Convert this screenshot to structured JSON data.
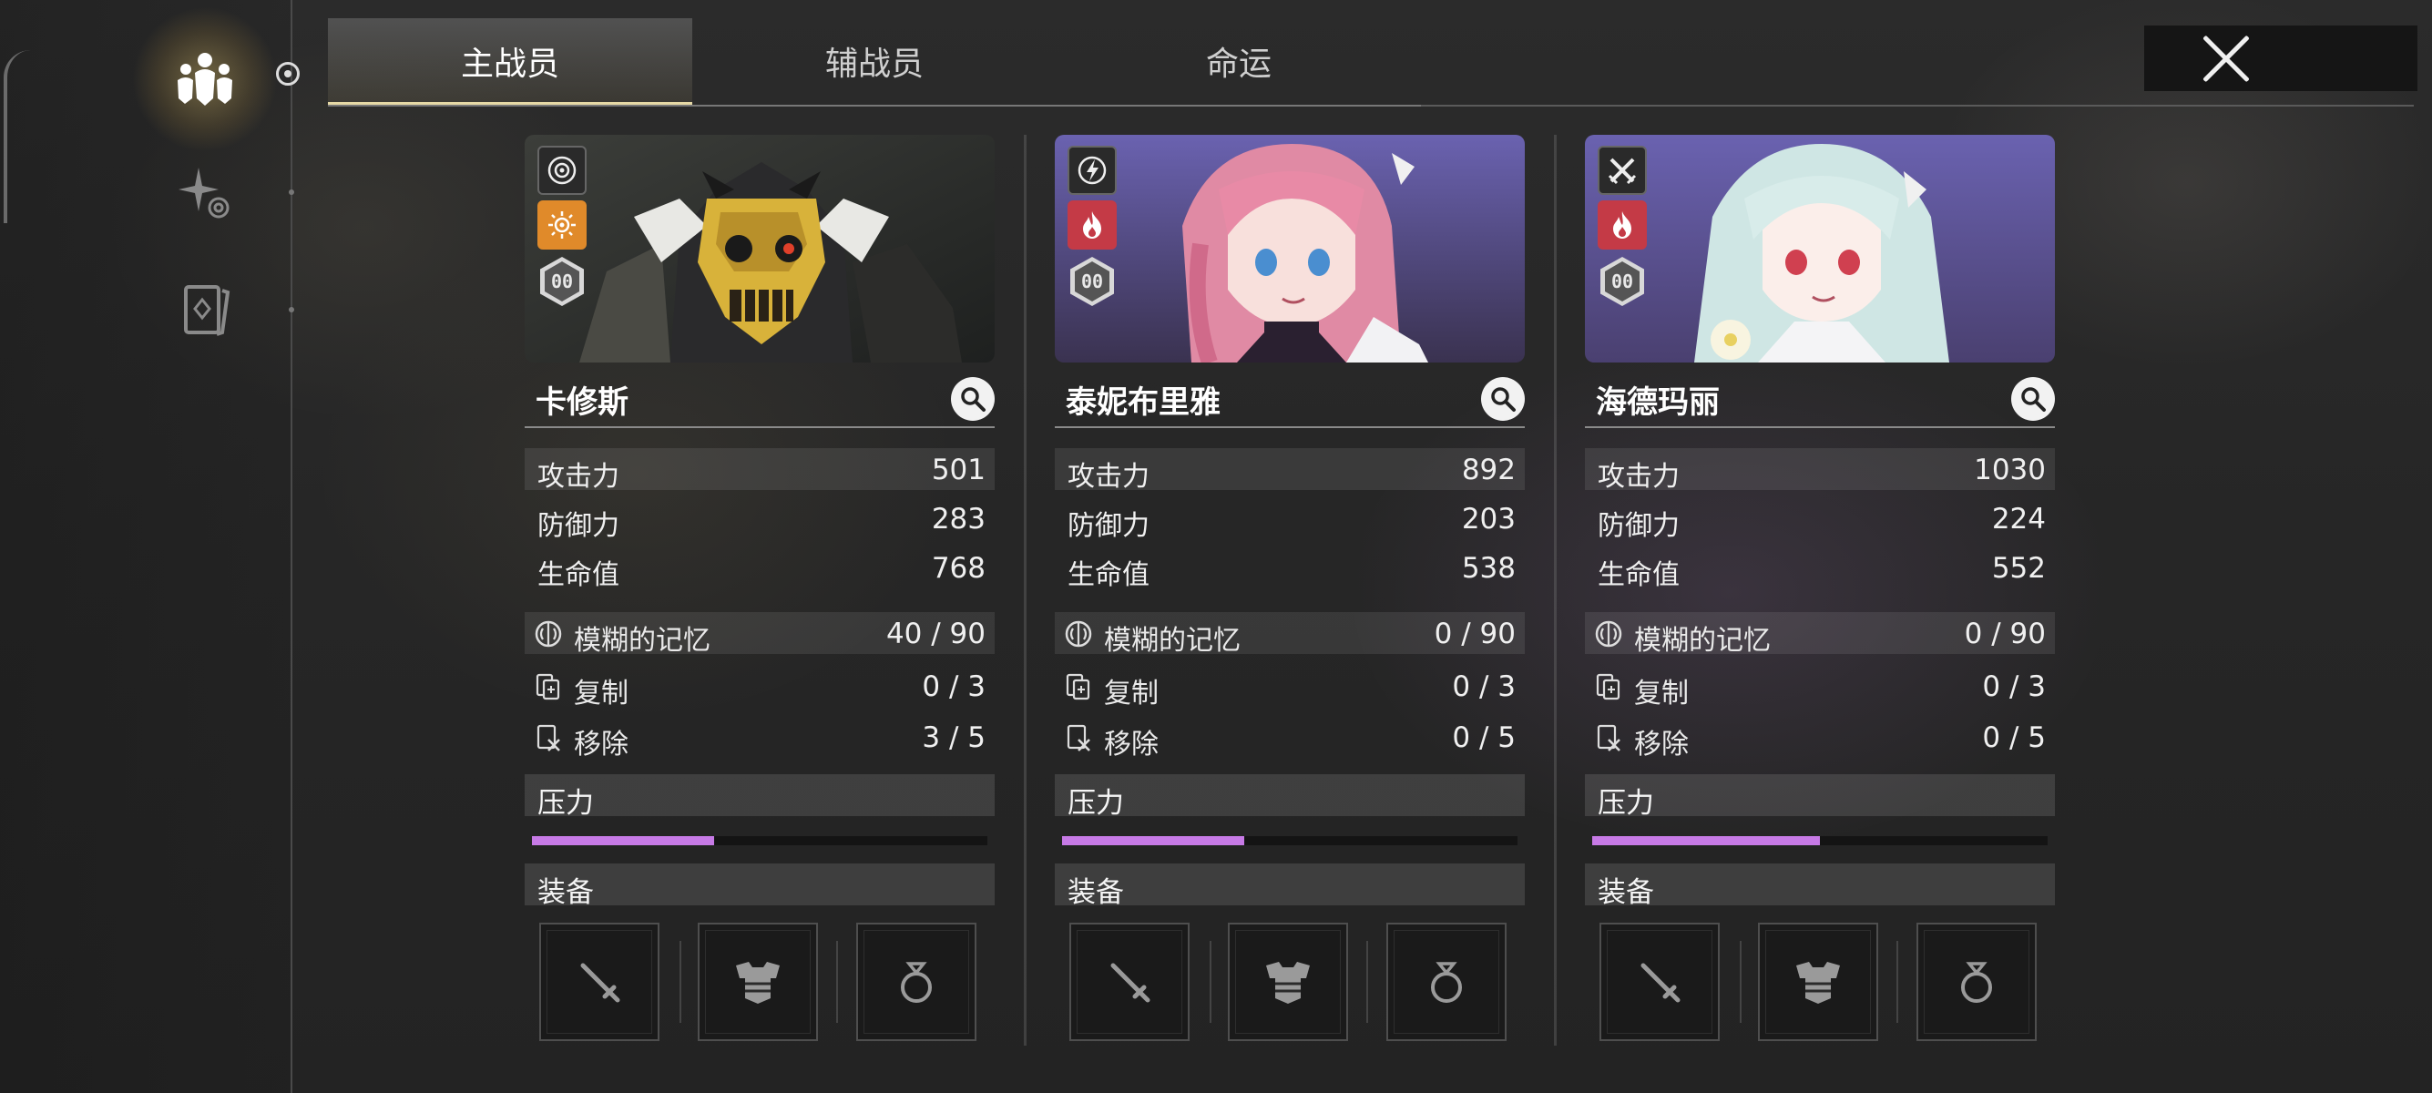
{
  "tabs": [
    "主战员",
    "辅战员",
    "命运"
  ],
  "active_tab": 0,
  "colors": {
    "pressure_fill": "#c77ae6",
    "tab_accent": "#e6d9a6"
  },
  "stat_labels": {
    "atk": "攻击力",
    "def": "防御力",
    "hp": "生命值",
    "memory": "模糊的记忆",
    "copy": "复制",
    "remove": "移除",
    "pressure": "压力",
    "equipment": "装备"
  },
  "rank_badge": "00",
  "cards": [
    {
      "name": "卡修斯",
      "role_icon": "target-icon",
      "element_icon": "sun-icon",
      "element_color": "#e08a2a",
      "atk": "501",
      "def": "283",
      "hp": "768",
      "memory": "40 / 90",
      "copy": "0 / 3",
      "remove": "3 / 5",
      "pressure": 0.4
    },
    {
      "name": "泰妮布里雅",
      "role_icon": "lightning-icon",
      "element_icon": "flame-icon",
      "element_color": "#c43a46",
      "atk": "892",
      "def": "203",
      "hp": "538",
      "memory": "0 / 90",
      "copy": "0 / 3",
      "remove": "0 / 5",
      "pressure": 0.4
    },
    {
      "name": "海德玛丽",
      "role_icon": "crossed-swords-icon",
      "element_icon": "flame-icon",
      "element_color": "#c43a46",
      "atk": "1030",
      "def": "224",
      "hp": "552",
      "memory": "0 / 90",
      "copy": "0 / 3",
      "remove": "0 / 5",
      "pressure": 0.5
    }
  ]
}
